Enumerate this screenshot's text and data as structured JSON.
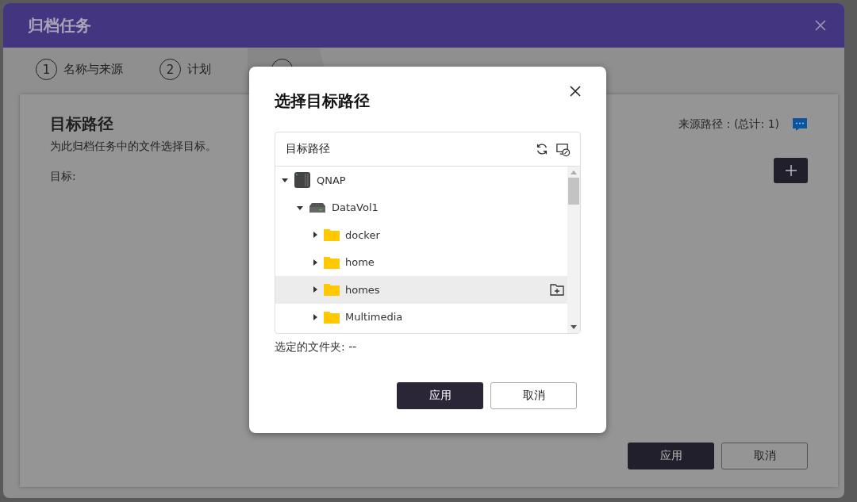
{
  "window": {
    "title": "归档任务"
  },
  "steps": [
    {
      "number": "1",
      "label": "名称与来源",
      "selected": false
    },
    {
      "number": "2",
      "label": "计划",
      "selected": false
    },
    {
      "selected": true
    }
  ],
  "content": {
    "title": "目标路径",
    "description": "为此归档任务中的文件选择目标。",
    "target_label": "目标:",
    "source_label": "来源路径：(总计: 1)"
  },
  "buttons": [
    "应用",
    "取消"
  ],
  "dialog": {
    "title": "选择目标路径",
    "panel_title": "目标路径",
    "tree": [
      {
        "kind": "nas",
        "label": "QNAP",
        "expanded": true,
        "selected": false,
        "children": [
          {
            "kind": "volume",
            "label": "DataVol1",
            "expanded": true,
            "selected": false,
            "children": [
              {
                "kind": "folder",
                "label": "docker",
                "expanded": false,
                "selected": false
              },
              {
                "kind": "folder",
                "label": "home",
                "expanded": false,
                "selected": false
              },
              {
                "kind": "folder",
                "label": "homes",
                "expanded": false,
                "selected": true
              },
              {
                "kind": "folder",
                "label": "Multimedia",
                "expanded": false,
                "selected": false
              }
            ]
          }
        ]
      }
    ],
    "selected_folder": "选定的文件夹: --",
    "buttons": [
      "应用",
      "取消"
    ]
  }
}
